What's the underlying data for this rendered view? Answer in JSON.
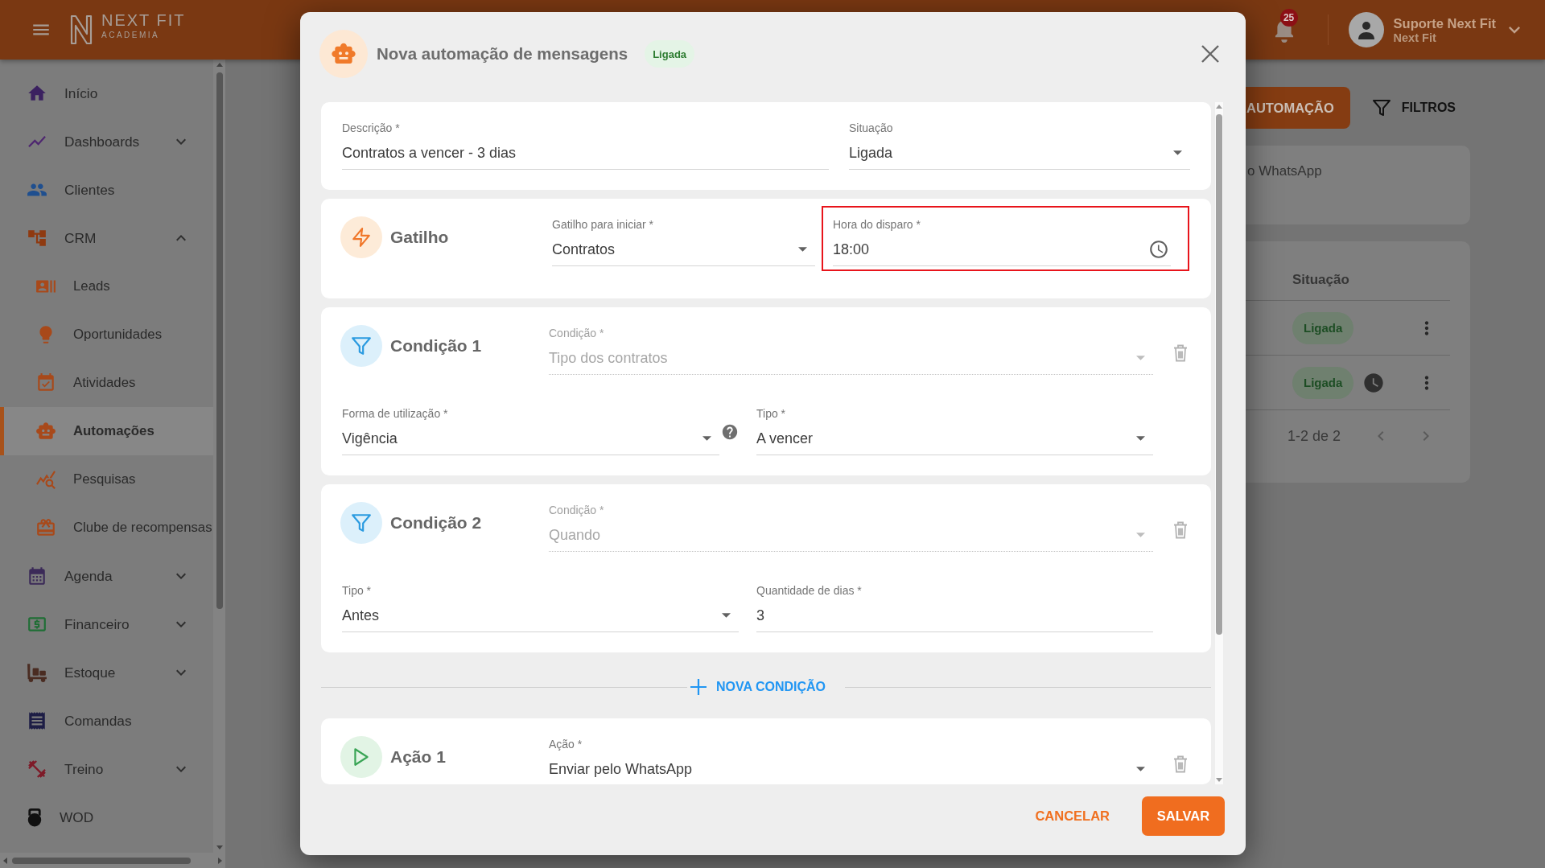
{
  "header": {
    "logo": {
      "name": "NEXT FIT",
      "tagline": "ACADEMIA"
    },
    "notifications": {
      "count": "25"
    },
    "user": {
      "name": "Suporte Next Fit",
      "company": "Next Fit"
    }
  },
  "sidebar": {
    "items": [
      {
        "label": "Início",
        "selected": false
      },
      {
        "label": "Dashboards",
        "selected": false,
        "expanded": false
      },
      {
        "label": "Clientes",
        "selected": false
      },
      {
        "label": "CRM",
        "selected": false,
        "expanded": true,
        "children": [
          {
            "label": "Leads",
            "selected": false
          },
          {
            "label": "Oportunidades",
            "selected": false
          },
          {
            "label": "Atividades",
            "selected": false
          },
          {
            "label": "Automações",
            "selected": true
          },
          {
            "label": "Pesquisas",
            "selected": false
          },
          {
            "label": "Clube de recompensas",
            "selected": false
          }
        ]
      },
      {
        "label": "Agenda",
        "selected": false,
        "expanded": false
      },
      {
        "label": "Financeiro",
        "selected": false,
        "expanded": false
      },
      {
        "label": "Estoque",
        "selected": false,
        "expanded": false
      },
      {
        "label": "Comandas",
        "selected": false
      },
      {
        "label": "Treino",
        "selected": false,
        "expanded": false
      },
      {
        "label": "WOD",
        "selected": false
      }
    ]
  },
  "page": {
    "toolbar": {
      "add_button": "AUTOMAÇÃO",
      "filter_button": "FILTROS"
    },
    "info_card": {
      "text": "o WhatsApp"
    },
    "table": {
      "columns": [
        "Situação"
      ],
      "rows": [
        {
          "status": "Ligada",
          "clock": false
        },
        {
          "status": "Ligada",
          "clock": true
        }
      ],
      "pagination": "1-2 de 2"
    }
  },
  "dialog": {
    "title": "Nova automação de mensagens",
    "status": "Ligada",
    "sections": [
      {
        "kind": "general",
        "removable": false,
        "rows": [
          [
            {
              "kind": "text",
              "label": "Descrição *",
              "value": "Contratos a vencer - 3 dias",
              "disabled": false,
              "highlighted": false,
              "help": false
            },
            {
              "kind": "select",
              "label": "Situação",
              "value": "Ligada",
              "disabled": false,
              "highlighted": false,
              "help": false
            }
          ]
        ]
      },
      {
        "kind": "trigger",
        "title": "Gatilho",
        "removable": false,
        "rows": [
          [
            {
              "kind": "select",
              "label": "Gatilho para iniciar *",
              "value": "Contratos",
              "disabled": false,
              "highlighted": false,
              "help": false
            },
            {
              "kind": "time",
              "label": "Hora do disparo *",
              "value": "18:00",
              "disabled": false,
              "highlighted": true,
              "help": false
            }
          ]
        ]
      },
      {
        "kind": "condition",
        "title": "Condição 1",
        "removable": true,
        "rows": [
          [
            {
              "kind": "select",
              "label": "Condição *",
              "value": "Tipo dos contratos",
              "disabled": true,
              "highlighted": false,
              "help": false
            }
          ],
          [
            {
              "kind": "select",
              "label": "Forma de utilização *",
              "value": "Vigência",
              "disabled": false,
              "highlighted": false,
              "help": true
            },
            {
              "kind": "select",
              "label": "Tipo *",
              "value": "A vencer",
              "disabled": false,
              "highlighted": false,
              "help": false
            }
          ]
        ]
      },
      {
        "kind": "condition",
        "title": "Condição 2",
        "removable": true,
        "rows": [
          [
            {
              "kind": "select",
              "label": "Condição *",
              "value": "Quando",
              "disabled": true,
              "highlighted": false,
              "help": false
            }
          ],
          [
            {
              "kind": "select",
              "label": "Tipo *",
              "value": "Antes",
              "disabled": false,
              "highlighted": false,
              "help": false
            },
            {
              "kind": "text",
              "label": "Quantidade de dias *",
              "value": "3",
              "disabled": false,
              "highlighted": false,
              "help": false
            }
          ]
        ]
      },
      {
        "kind": "add",
        "label": "NOVA CONDIÇÃO"
      },
      {
        "kind": "action",
        "title": "Ação 1",
        "removable": true,
        "rows": [
          [
            {
              "kind": "select",
              "label": "Ação *",
              "value": "Enviar pelo WhatsApp",
              "disabled": false,
              "highlighted": false,
              "help": false
            }
          ]
        ]
      }
    ],
    "buttons": {
      "cancel": "CANCELAR",
      "save": "SALVAR"
    }
  }
}
